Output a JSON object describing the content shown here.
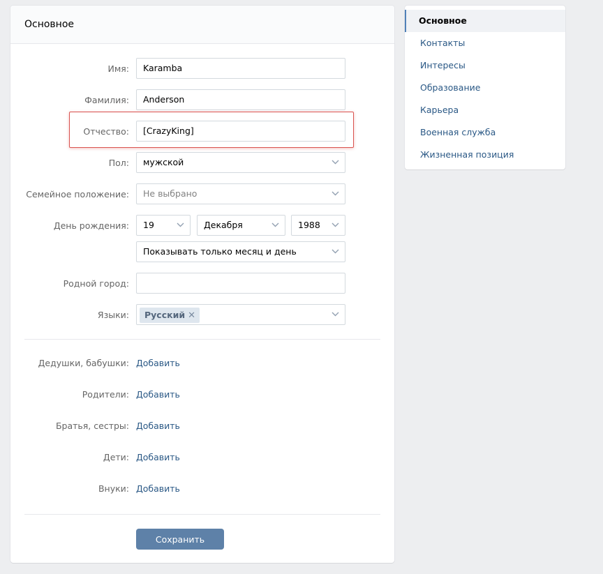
{
  "panel": {
    "title": "Основное"
  },
  "form": {
    "first_name_label": "Имя:",
    "first_name_value": "Karamba",
    "last_name_label": "Фамилия:",
    "last_name_value": "Anderson",
    "patronymic_label": "Отчество:",
    "patronymic_value": "[CrazyKing]",
    "gender_label": "Пол:",
    "gender_value": "мужской",
    "marital_label": "Семейное положение:",
    "marital_value": "Не выбрано",
    "birthday_label": "День рождения:",
    "birth_day": "19",
    "birth_month": "Декабря",
    "birth_year": "1988",
    "birthday_visibility": "Показывать только месяц и день",
    "hometown_label": "Родной город:",
    "hometown_value": "",
    "languages_label": "Языки:",
    "language_tag": "Русский",
    "language_tag_remove": "✕"
  },
  "relatives": [
    {
      "label": "Дедушки, бабушки:",
      "action": "Добавить"
    },
    {
      "label": "Родители:",
      "action": "Добавить"
    },
    {
      "label": "Братья, сестры:",
      "action": "Добавить"
    },
    {
      "label": "Дети:",
      "action": "Добавить"
    },
    {
      "label": "Внуки:",
      "action": "Добавить"
    }
  ],
  "save_label": "Сохранить",
  "menu": [
    {
      "label": "Основное",
      "active": true
    },
    {
      "label": "Контакты"
    },
    {
      "label": "Интересы"
    },
    {
      "label": "Образование"
    },
    {
      "label": "Карьера"
    },
    {
      "label": "Военная служба"
    },
    {
      "label": "Жизненная позиция"
    }
  ],
  "colors": {
    "accent": "#5181b8",
    "link": "#2a5885",
    "button": "#5e81a8",
    "highlight": "#d9534f",
    "background": "#edeef0"
  }
}
